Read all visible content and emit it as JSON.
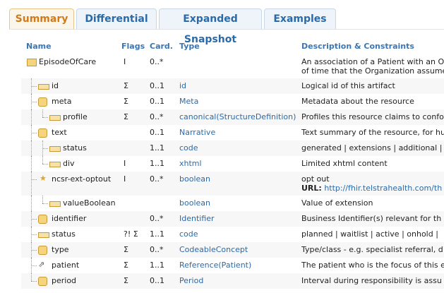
{
  "tabs": [
    {
      "label": "Summary",
      "active": true
    },
    {
      "label": "Differential",
      "active": false
    },
    {
      "label": "Expanded Snapshot",
      "active": false
    },
    {
      "label": "Examples",
      "active": false
    }
  ],
  "headers": {
    "name": "Name",
    "flags": "Flags",
    "card": "Card.",
    "type": "Type",
    "desc": "Description & Constraints"
  },
  "rows": [
    {
      "name": "EpisodeOfCare",
      "flags": "I",
      "card": "0..*",
      "type": "",
      "desc": "An association of a Patient with an O",
      "desc_line2": "of time that the Organization assume"
    },
    {
      "name": "id",
      "flags": "Σ",
      "card": "0..1",
      "type": "id",
      "desc": "Logical id of this artifact"
    },
    {
      "name": "meta",
      "flags": "Σ",
      "card": "0..1",
      "type": "Meta",
      "desc": "Metadata about the resource"
    },
    {
      "name": "profile",
      "flags": "Σ",
      "card": "0..*",
      "type": "canonical(StructureDefinition)",
      "desc": "Profiles this resource claims to confo"
    },
    {
      "name": "text",
      "flags": "",
      "card": "0..1",
      "type": "Narrative",
      "desc": "Text summary of the resource, for hu"
    },
    {
      "name": "status",
      "flags": "",
      "card": "1..1",
      "type": "code",
      "desc": "generated | extensions | additional |"
    },
    {
      "name": "div",
      "flags": "I",
      "card": "1..1",
      "type": "xhtml",
      "desc": "Limited xhtml content"
    },
    {
      "name": "ncsr-ext-optout",
      "flags": "I",
      "card": "0..*",
      "type": "boolean",
      "desc": "opt out",
      "url_label": "URL:",
      "url": "http://fhir.telstrahealth.com/th"
    },
    {
      "name": "valueBoolean",
      "flags": "",
      "card": "",
      "type": "boolean",
      "desc": "Value of extension"
    },
    {
      "name": "identifier",
      "flags": "",
      "card": "0..*",
      "type": "Identifier",
      "desc": "Business Identifier(s) relevant for th"
    },
    {
      "name": "status",
      "flags": "?! Σ",
      "card": "1..1",
      "type": "code",
      "desc": "planned | waitlist | active | onhold | "
    },
    {
      "name": "type",
      "flags": "Σ",
      "card": "0..*",
      "type": "CodeableConcept",
      "desc": "Type/class - e.g. specialist referral, d"
    },
    {
      "name": "patient",
      "flags": "Σ",
      "card": "1..1",
      "type": "Reference(Patient)",
      "desc": "The patient who is the focus of this e"
    },
    {
      "name": "period",
      "flags": "Σ",
      "card": "0..1",
      "type": "Period",
      "desc": "Interval during responsibility is assu"
    }
  ]
}
